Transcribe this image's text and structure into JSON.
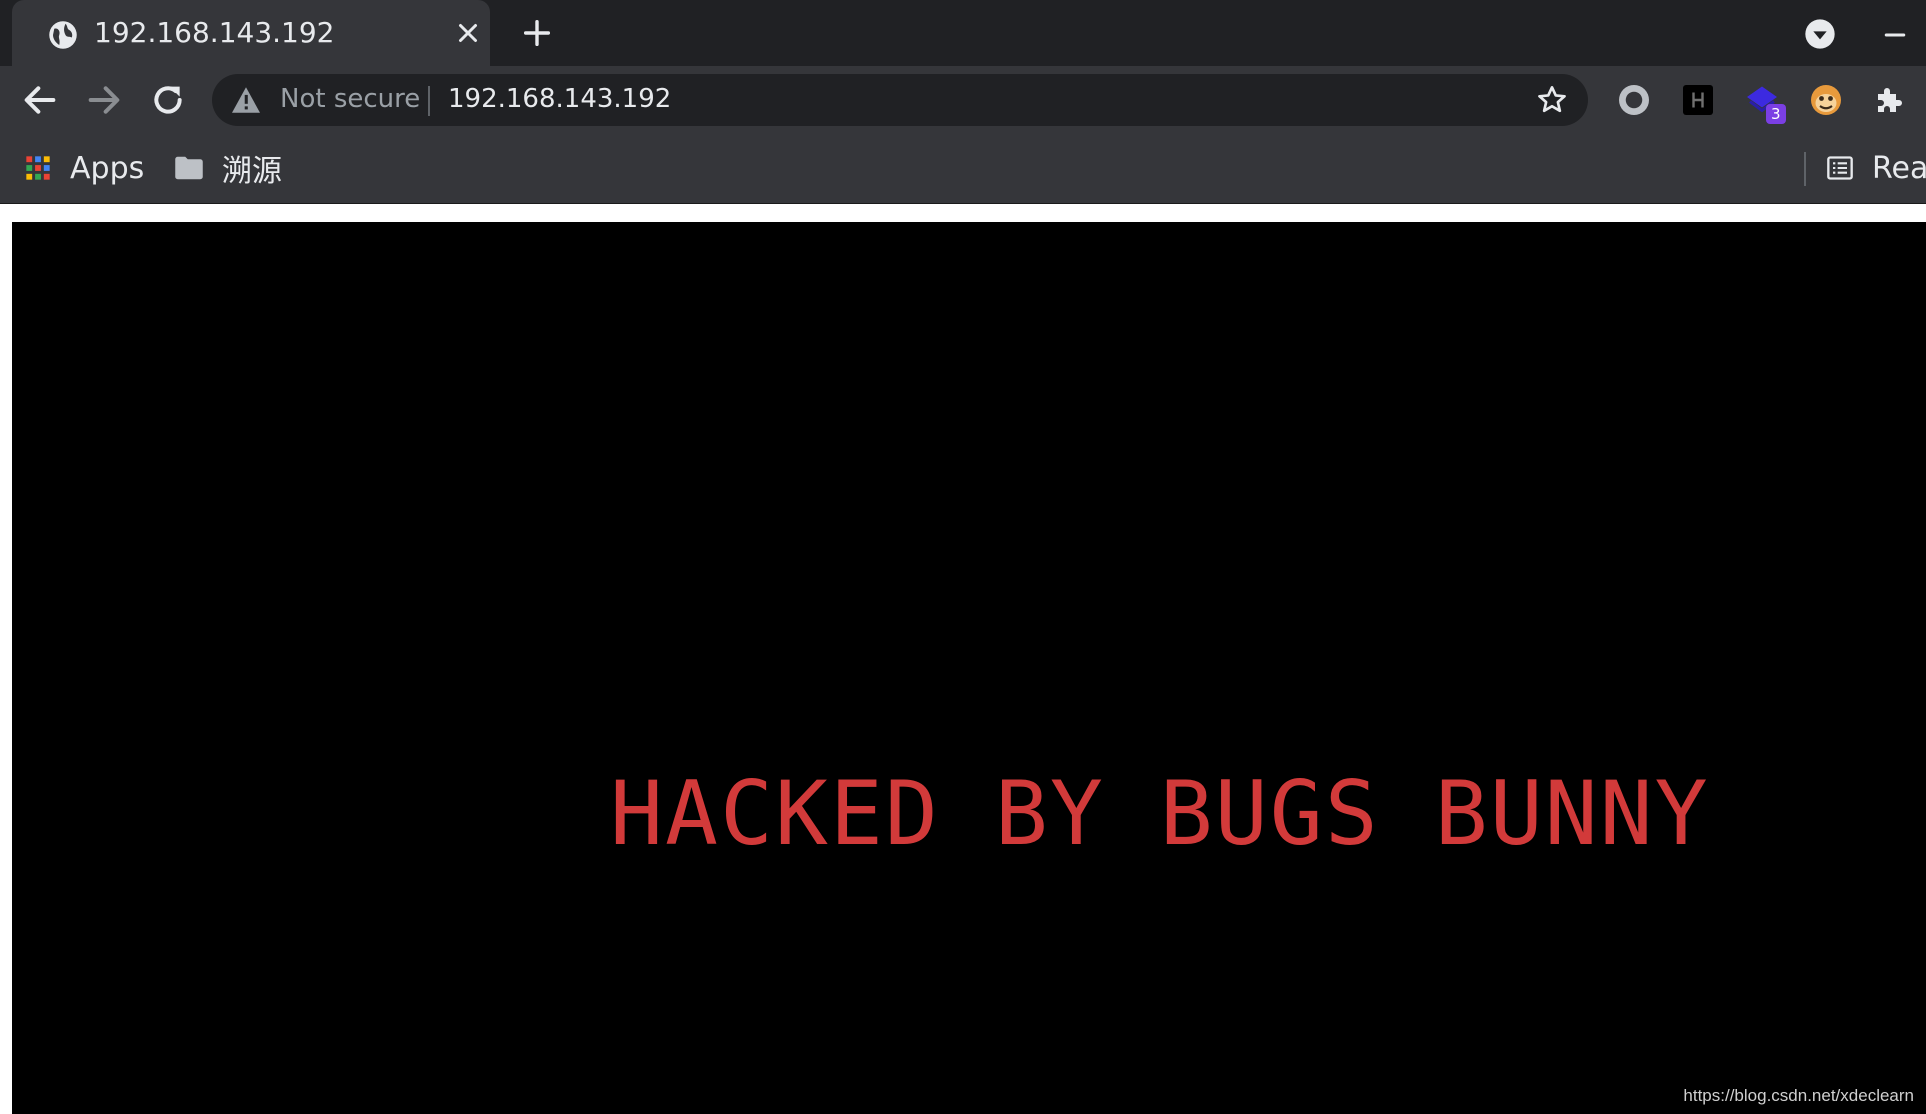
{
  "tab": {
    "title": "192.168.143.192",
    "favicon": "globe-icon"
  },
  "toolbar": {
    "back": "back-arrow-icon",
    "forward": "forward-arrow-icon",
    "reload": "reload-icon"
  },
  "omnibox": {
    "security_label": "Not secure",
    "url": "192.168.143.192"
  },
  "extensions": {
    "badge_count": "3",
    "badge_color": "#7b3fe4"
  },
  "bookmarks": {
    "items": [
      {
        "label": "Apps",
        "icon": "apps-grid-icon"
      },
      {
        "label": "溯源",
        "icon": "folder-icon"
      }
    ],
    "reading_list_label": "Rea"
  },
  "page": {
    "headline": "HACKED BY BUGS BUNNY",
    "headline_color": "#d23a3a",
    "background": "#000000",
    "watermark": "https://blog.csdn.net/xdeclearn"
  }
}
